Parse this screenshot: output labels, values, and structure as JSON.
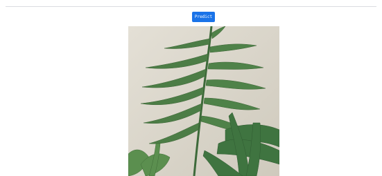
{
  "toolbar": {
    "predict_label": "Predict",
    "accent_color": "#1a73e8"
  },
  "main": {
    "image_subject": "plant-leaf-photo"
  }
}
